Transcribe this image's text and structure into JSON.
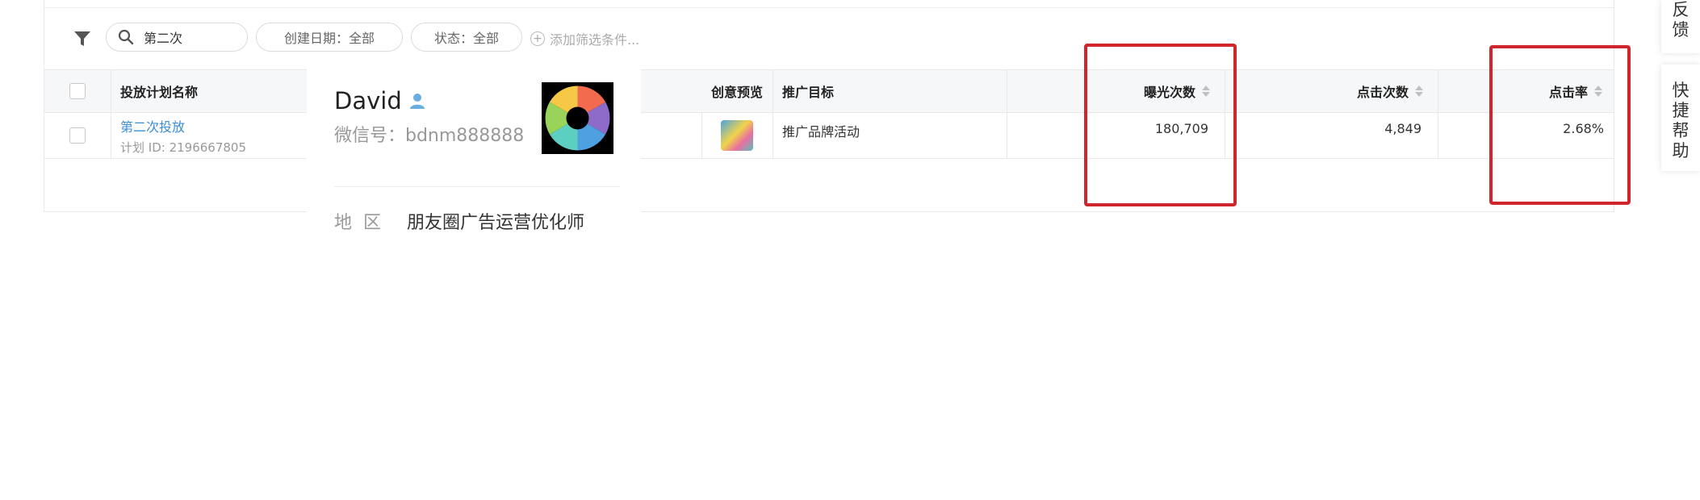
{
  "filters": {
    "search_value": "第二次",
    "create_date": "创建日期：全部",
    "status": "状态：全部",
    "add_filter": "添加筛选条件..."
  },
  "table": {
    "headers": {
      "plan_name": "投放计划名称",
      "creative_preview": "创意预览",
      "promotion_goal": "推广目标",
      "impressions": "曝光次数",
      "clicks": "点击次数",
      "ctr": "点击率"
    },
    "rows": [
      {
        "plan_name": "第二次投放",
        "plan_id": "计划 ID: 2196667805",
        "promotion_goal": "推广品牌活动",
        "impressions": "180,709",
        "clicks": "4,849",
        "ctr": "2.68%"
      }
    ]
  },
  "profile_card": {
    "name": "David",
    "wechat_id": "微信号：bdnm888888",
    "region_label": "地区",
    "region_value": "朋友圈广告运营优化师"
  },
  "side_panel": {
    "feedback": "反馈",
    "quick_help": "快捷帮助"
  },
  "colors": {
    "highlight_red": "#d0262b",
    "link_blue": "#3a8ed4"
  }
}
